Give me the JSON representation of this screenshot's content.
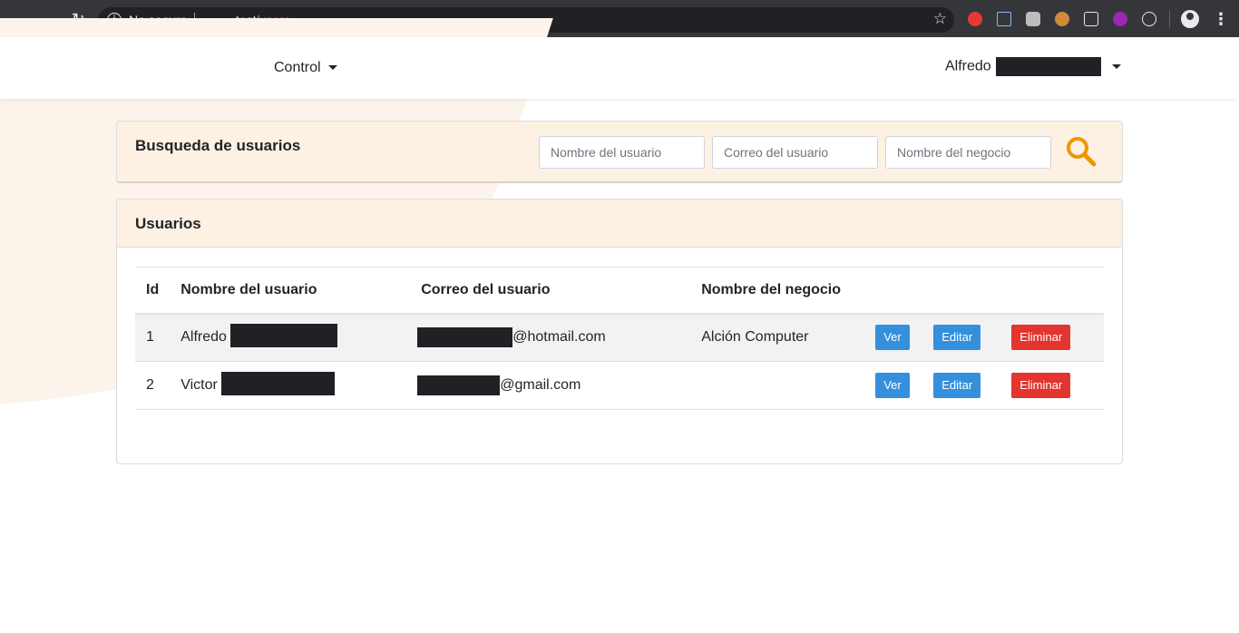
{
  "browser": {
    "secure_label": "No seguro",
    "url_host": ".test",
    "url_path": "/users"
  },
  "nav": {
    "control_label": "Control",
    "user_name": "Alfredo"
  },
  "search": {
    "title": "Busqueda de usuarios",
    "placeholders": [
      "Nombre del usuario",
      "Correo del usuario",
      "Nombre del negocio"
    ],
    "accent_color": "#f09600"
  },
  "users": {
    "title": "Usuarios",
    "columns": [
      "Id",
      "Nombre del usuario",
      "Correo del usuario",
      "Nombre del negocio"
    ],
    "rows": [
      {
        "id": "1",
        "name": "Alfredo",
        "email_suffix": "@hotmail.com",
        "business": "Alción Computer",
        "view": "Ver",
        "edit": "Editar",
        "delete": "Eliminar"
      },
      {
        "id": "2",
        "name": "Victor",
        "email_suffix": "@gmail.com",
        "business": "",
        "view": "Ver",
        "edit": "Editar",
        "delete": "Eliminar"
      }
    ]
  }
}
